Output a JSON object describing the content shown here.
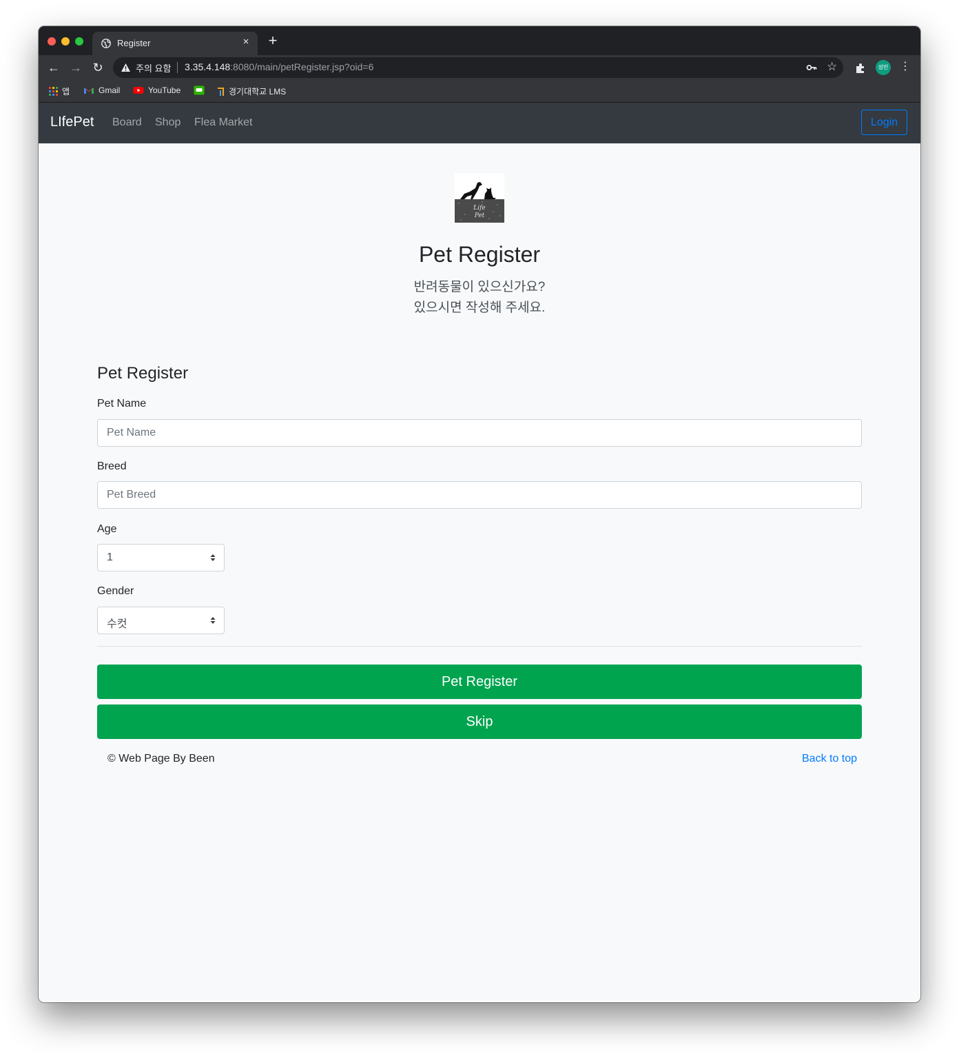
{
  "browser": {
    "tab_title": "Register",
    "tab_close": "×",
    "new_tab": "+",
    "security_warning": "주의 요함",
    "url_host": "3.35.4.148",
    "url_path": ":8080/main/petRegister.jsp?oid=6",
    "profile_initials": "성빈",
    "bookmarks": [
      {
        "label": "앱",
        "icon": "apps-icon"
      },
      {
        "label": "Gmail",
        "icon": "gmail-icon"
      },
      {
        "label": "YouTube",
        "icon": "youtube-icon"
      },
      {
        "label": "",
        "icon": "chat-icon"
      },
      {
        "label": "경기대학교 LMS",
        "icon": "lms-icon"
      }
    ]
  },
  "navbar": {
    "brand": "LIfePet",
    "links": [
      "Board",
      "Shop",
      "Flea Market"
    ],
    "login": "Login"
  },
  "hero": {
    "title": "Pet Register",
    "subtitle_line1": "반려동물이 있으신가요?",
    "subtitle_line2": "있으시면 작성해 주세요."
  },
  "form": {
    "title": "Pet Register",
    "pet_name_label": "Pet Name",
    "pet_name_placeholder": "Pet Name",
    "breed_label": "Breed",
    "breed_placeholder": "Pet Breed",
    "age_label": "Age",
    "age_value": "1",
    "gender_label": "Gender",
    "gender_value": "수컷",
    "submit": "Pet Register",
    "skip": "Skip"
  },
  "footer": {
    "copyright": "© Web Page By Been",
    "back_to_top": "Back to top"
  },
  "colors": {
    "navbar_bg": "#343a40",
    "primary": "#007bff",
    "success": "#00a44f",
    "page_bg": "#f8f9fa"
  }
}
